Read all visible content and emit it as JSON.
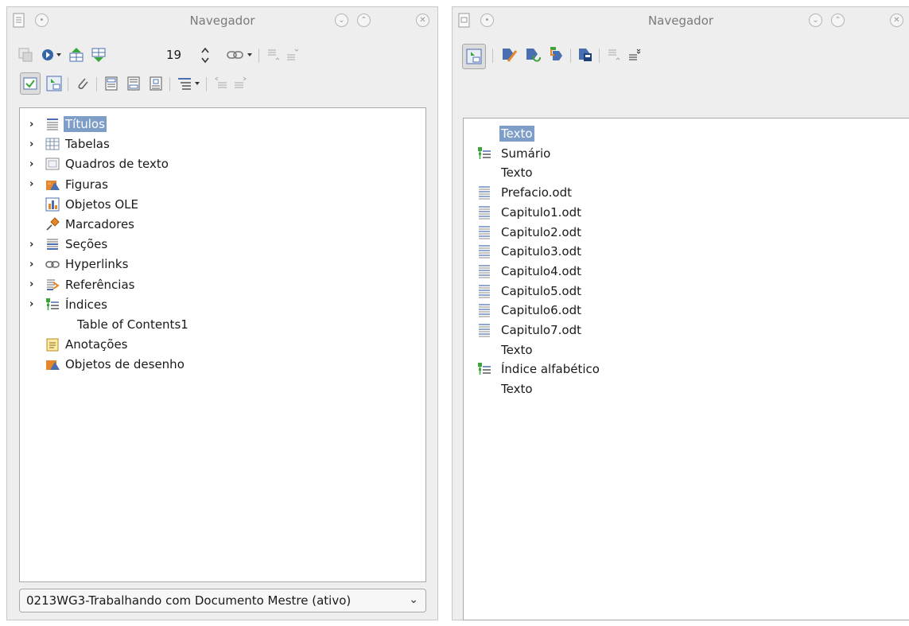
{
  "left_window": {
    "title": "Navegador",
    "page_number": "19",
    "tree": [
      {
        "label": "Títulos",
        "expandable": true,
        "selected": true,
        "icon": "headings-icon"
      },
      {
        "label": "Tabelas",
        "expandable": true,
        "icon": "table-icon"
      },
      {
        "label": "Quadros de texto",
        "expandable": true,
        "icon": "text-frame-icon"
      },
      {
        "label": "Figuras",
        "expandable": true,
        "icon": "image-icon"
      },
      {
        "label": "Objetos OLE",
        "expandable": false,
        "icon": "ole-object-icon"
      },
      {
        "label": "Marcadores",
        "expandable": false,
        "icon": "bookmark-pin-icon"
      },
      {
        "label": "Seções",
        "expandable": true,
        "icon": "sections-icon"
      },
      {
        "label": "Hyperlinks",
        "expandable": true,
        "icon": "hyperlink-icon"
      },
      {
        "label": "Referências",
        "expandable": true,
        "icon": "references-icon"
      },
      {
        "label": "Índices",
        "expandable": true,
        "icon": "indexes-icon"
      },
      {
        "label": "Table of Contents1",
        "expandable": false,
        "icon": null
      },
      {
        "label": "Anotações",
        "expandable": false,
        "icon": "comment-icon"
      },
      {
        "label": "Objetos de desenho",
        "expandable": false,
        "icon": "drawing-object-icon"
      }
    ],
    "document_select": "0213WG3-Trabalhando com Documento Mestre (ativo)"
  },
  "right_window": {
    "title": "Navegador",
    "tree": [
      {
        "label": "Texto",
        "selected": true,
        "icon": null
      },
      {
        "label": "Sumário",
        "icon": "index-icon"
      },
      {
        "label": "Texto",
        "icon": null
      },
      {
        "label": "Prefacio.odt",
        "icon": "file-lines-icon"
      },
      {
        "label": "Capitulo1.odt",
        "icon": "file-lines-icon"
      },
      {
        "label": "Capitulo2.odt",
        "icon": "file-lines-icon"
      },
      {
        "label": "Capitulo3.odt",
        "icon": "file-lines-icon"
      },
      {
        "label": "Capitulo4.odt",
        "icon": "file-lines-icon"
      },
      {
        "label": "Capitulo5.odt",
        "icon": "file-lines-icon"
      },
      {
        "label": "Capitulo6.odt",
        "icon": "file-lines-icon"
      },
      {
        "label": "Capitulo7.odt",
        "icon": "file-lines-icon"
      },
      {
        "label": "Texto",
        "icon": null
      },
      {
        "label": "Índice alfabético",
        "icon": "index-icon"
      },
      {
        "label": "Texto",
        "icon": null
      }
    ]
  },
  "colors": {
    "selection": "#7e9ec8",
    "window_bg": "#eeeeee",
    "tree_bg": "#ffffff",
    "icon_blue": "#4a6fb0",
    "icon_green": "#3aa53a",
    "icon_orange": "#e4862a"
  }
}
